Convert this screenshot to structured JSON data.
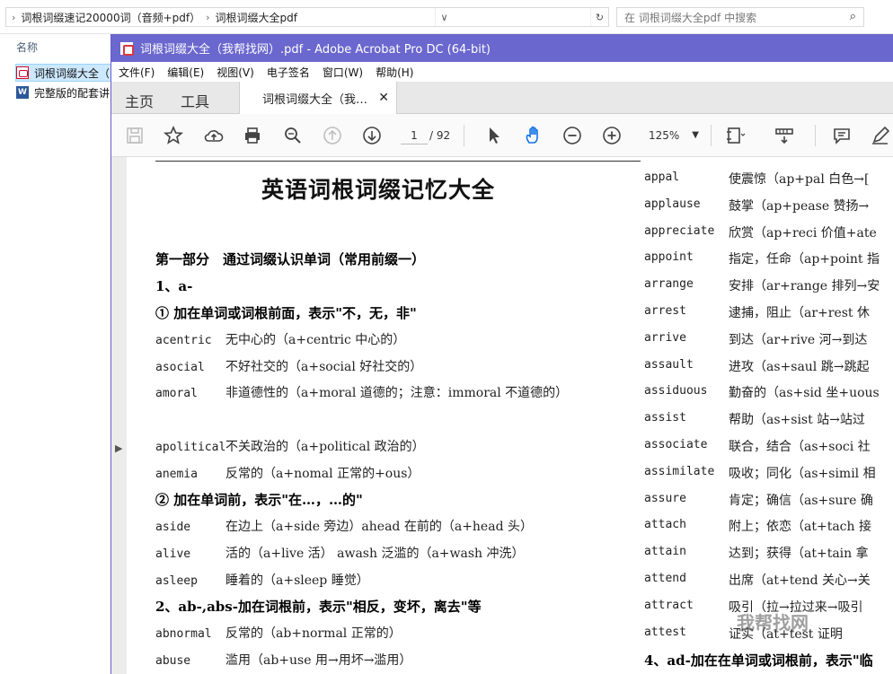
{
  "explorer": {
    "crumb1": "词根词缀速记20000词（音频+pdf）",
    "crumb2": "词根词缀大全pdf",
    "search_placeholder": "在 词根词缀大全pdf 中搜索",
    "column_header": "名称",
    "files": [
      "词根词缀大全（",
      "完整版的配套讲"
    ]
  },
  "acrobat": {
    "window_title": "词根词缀大全（我帮找网）.pdf - Adobe Acrobat Pro DC (64-bit)",
    "menu": [
      "文件(F)",
      "编辑(E)",
      "视图(V)",
      "电子签名",
      "窗口(W)",
      "帮助(H)"
    ],
    "tab_home": "主页",
    "tab_tools": "工具",
    "tab_doc": "词根词缀大全（我…",
    "page_current": "1",
    "page_total": "/ 92",
    "zoom": "125%"
  },
  "document": {
    "title": "英语词根词缀记忆大全",
    "left_lines": [
      {
        "text": "第一部分　通过词缀认识单词（常用前缀一）",
        "bold": true
      },
      {
        "text": "1、a-",
        "bold": true
      },
      {
        "text": "① 加在单词或词根前面，表示\"不，无，非\"",
        "bold": true
      },
      {
        "word": "acentric",
        "text": "无中心的（a+centric 中心的）"
      },
      {
        "word": "asocial",
        "text": "不好社交的（a+social 好社交的）"
      },
      {
        "word": "amoral",
        "text": "非道德性的（a+moral 道德的；注意：immoral 不道德的）"
      },
      {
        "word": "apolitical",
        "text": "不关政治的（a+political 政治的）"
      },
      {
        "word": "anemia",
        "text": "反常的（a+nomal 正常的+ous）"
      },
      {
        "text": "② 加在单词前，表示\"在…，…的\"",
        "bold": true
      },
      {
        "word": "aside",
        "text": "在边上（a+side 旁边）ahead 在前的（a+head 头）"
      },
      {
        "word": "alive",
        "text": "活的（a+live 活） awash 泛滥的（a+wash 冲洗）"
      },
      {
        "word": "asleep",
        "text": "睡着的（a+sleep 睡觉）"
      },
      {
        "text": "2、ab-,abs-加在词根前，表示\"相反，变坏，离去\"等",
        "bold": true
      },
      {
        "word": "abnormal",
        "text": "反常的（ab+normal 正常的）"
      },
      {
        "word": "abuse",
        "text": "滥用（ab+use 用→用坏→滥用）"
      }
    ],
    "right_lines": [
      {
        "word": "appal",
        "text": "使震惊（ap+pal 白色→["
      },
      {
        "word": "applause",
        "text": "鼓掌（ap+pease 赞扬→"
      },
      {
        "word": "appreciate",
        "text": "欣赏（ap+reci 价值+ate"
      },
      {
        "word": "appoint",
        "text": "指定，任命（ap+point 指"
      },
      {
        "word": "arrange",
        "text": "安排（ar+range 排列→安"
      },
      {
        "word": "arrest",
        "text": "逮捕，阻止（ar+rest 休"
      },
      {
        "word": "arrive",
        "text": "到达（ar+rive 河→到达"
      },
      {
        "word": "assault",
        "text": "进攻（as+saul 跳→跳起"
      },
      {
        "word": "assiduous",
        "text": "勤奋的（as+sid 坐+uous"
      },
      {
        "word": "assist",
        "text": "帮助（as+sist 站→站过"
      },
      {
        "word": "associate",
        "text": "联合，结合（as+soci 社"
      },
      {
        "word": "assimilate",
        "text": "吸收；同化（as+simil 相"
      },
      {
        "word": "assure",
        "text": "肯定；确信（as+sure 确"
      },
      {
        "word": "attach",
        "text": "附上；依恋（at+tach 接"
      },
      {
        "word": "attain",
        "text": "达到；获得（at+tain 拿"
      },
      {
        "word": "attend",
        "text": "出席（at+tend 关心→关"
      },
      {
        "word": "attract",
        "text": "吸引（拉→拉过来→吸引"
      },
      {
        "word": "attest",
        "text": "证实（at+test 证明"
      },
      {
        "text": "4、ad-加在在单词或词根前，表示\"临",
        "bold": true
      }
    ]
  },
  "watermark": "我帮找网"
}
